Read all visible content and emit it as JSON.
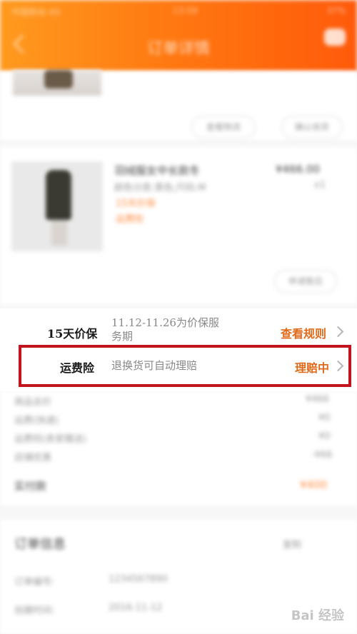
{
  "header": {
    "carrier": "中国移动 4G",
    "time": "13:59",
    "battery": "37%",
    "title": "订单详情"
  },
  "blurred": {
    "btn_view_logistics": "查看物流",
    "btn_confirm": "确认收货",
    "product_name": "羽绒服女中长款冬",
    "product_sku": "颜色分类:黑色;尺码:M",
    "product_price": "¥466.00",
    "product_qty": "x1",
    "tag_price_protect": "15天价保",
    "tag_shipping": "运费险",
    "btn_refund": "申请售后",
    "summary": [
      {
        "k": "商品总价",
        "v": "¥466"
      },
      {
        "k": "运费(快递)",
        "v": "¥0"
      },
      {
        "k": "运费险(卖家赠送)",
        "v": "¥0"
      },
      {
        "k": "店铺优惠",
        "v": "-¥66"
      }
    ],
    "paid_label": "实付款",
    "paid_value": "¥400",
    "order_info_title": "订单信息",
    "copy": "复制",
    "order_no_label": "订单编号:",
    "order_no": "1234567890",
    "time_label": "创建时间:",
    "time_value": "2016-11-12"
  },
  "rows": {
    "price_protect": {
      "label": "15天价保",
      "desc_line1": "11.12-11.26为价保服",
      "desc_line2": "务期",
      "action": "查看规则"
    },
    "shipping_insurance": {
      "label": "运费险",
      "desc": "退换货可自动理赔",
      "action": "理赔中"
    }
  },
  "watermark": "Bai 经验",
  "colors": {
    "header_start": "#ff9a1e",
    "header_end": "#ff5a0a",
    "action": "#e06a1a",
    "highlight": "#c2141c"
  }
}
